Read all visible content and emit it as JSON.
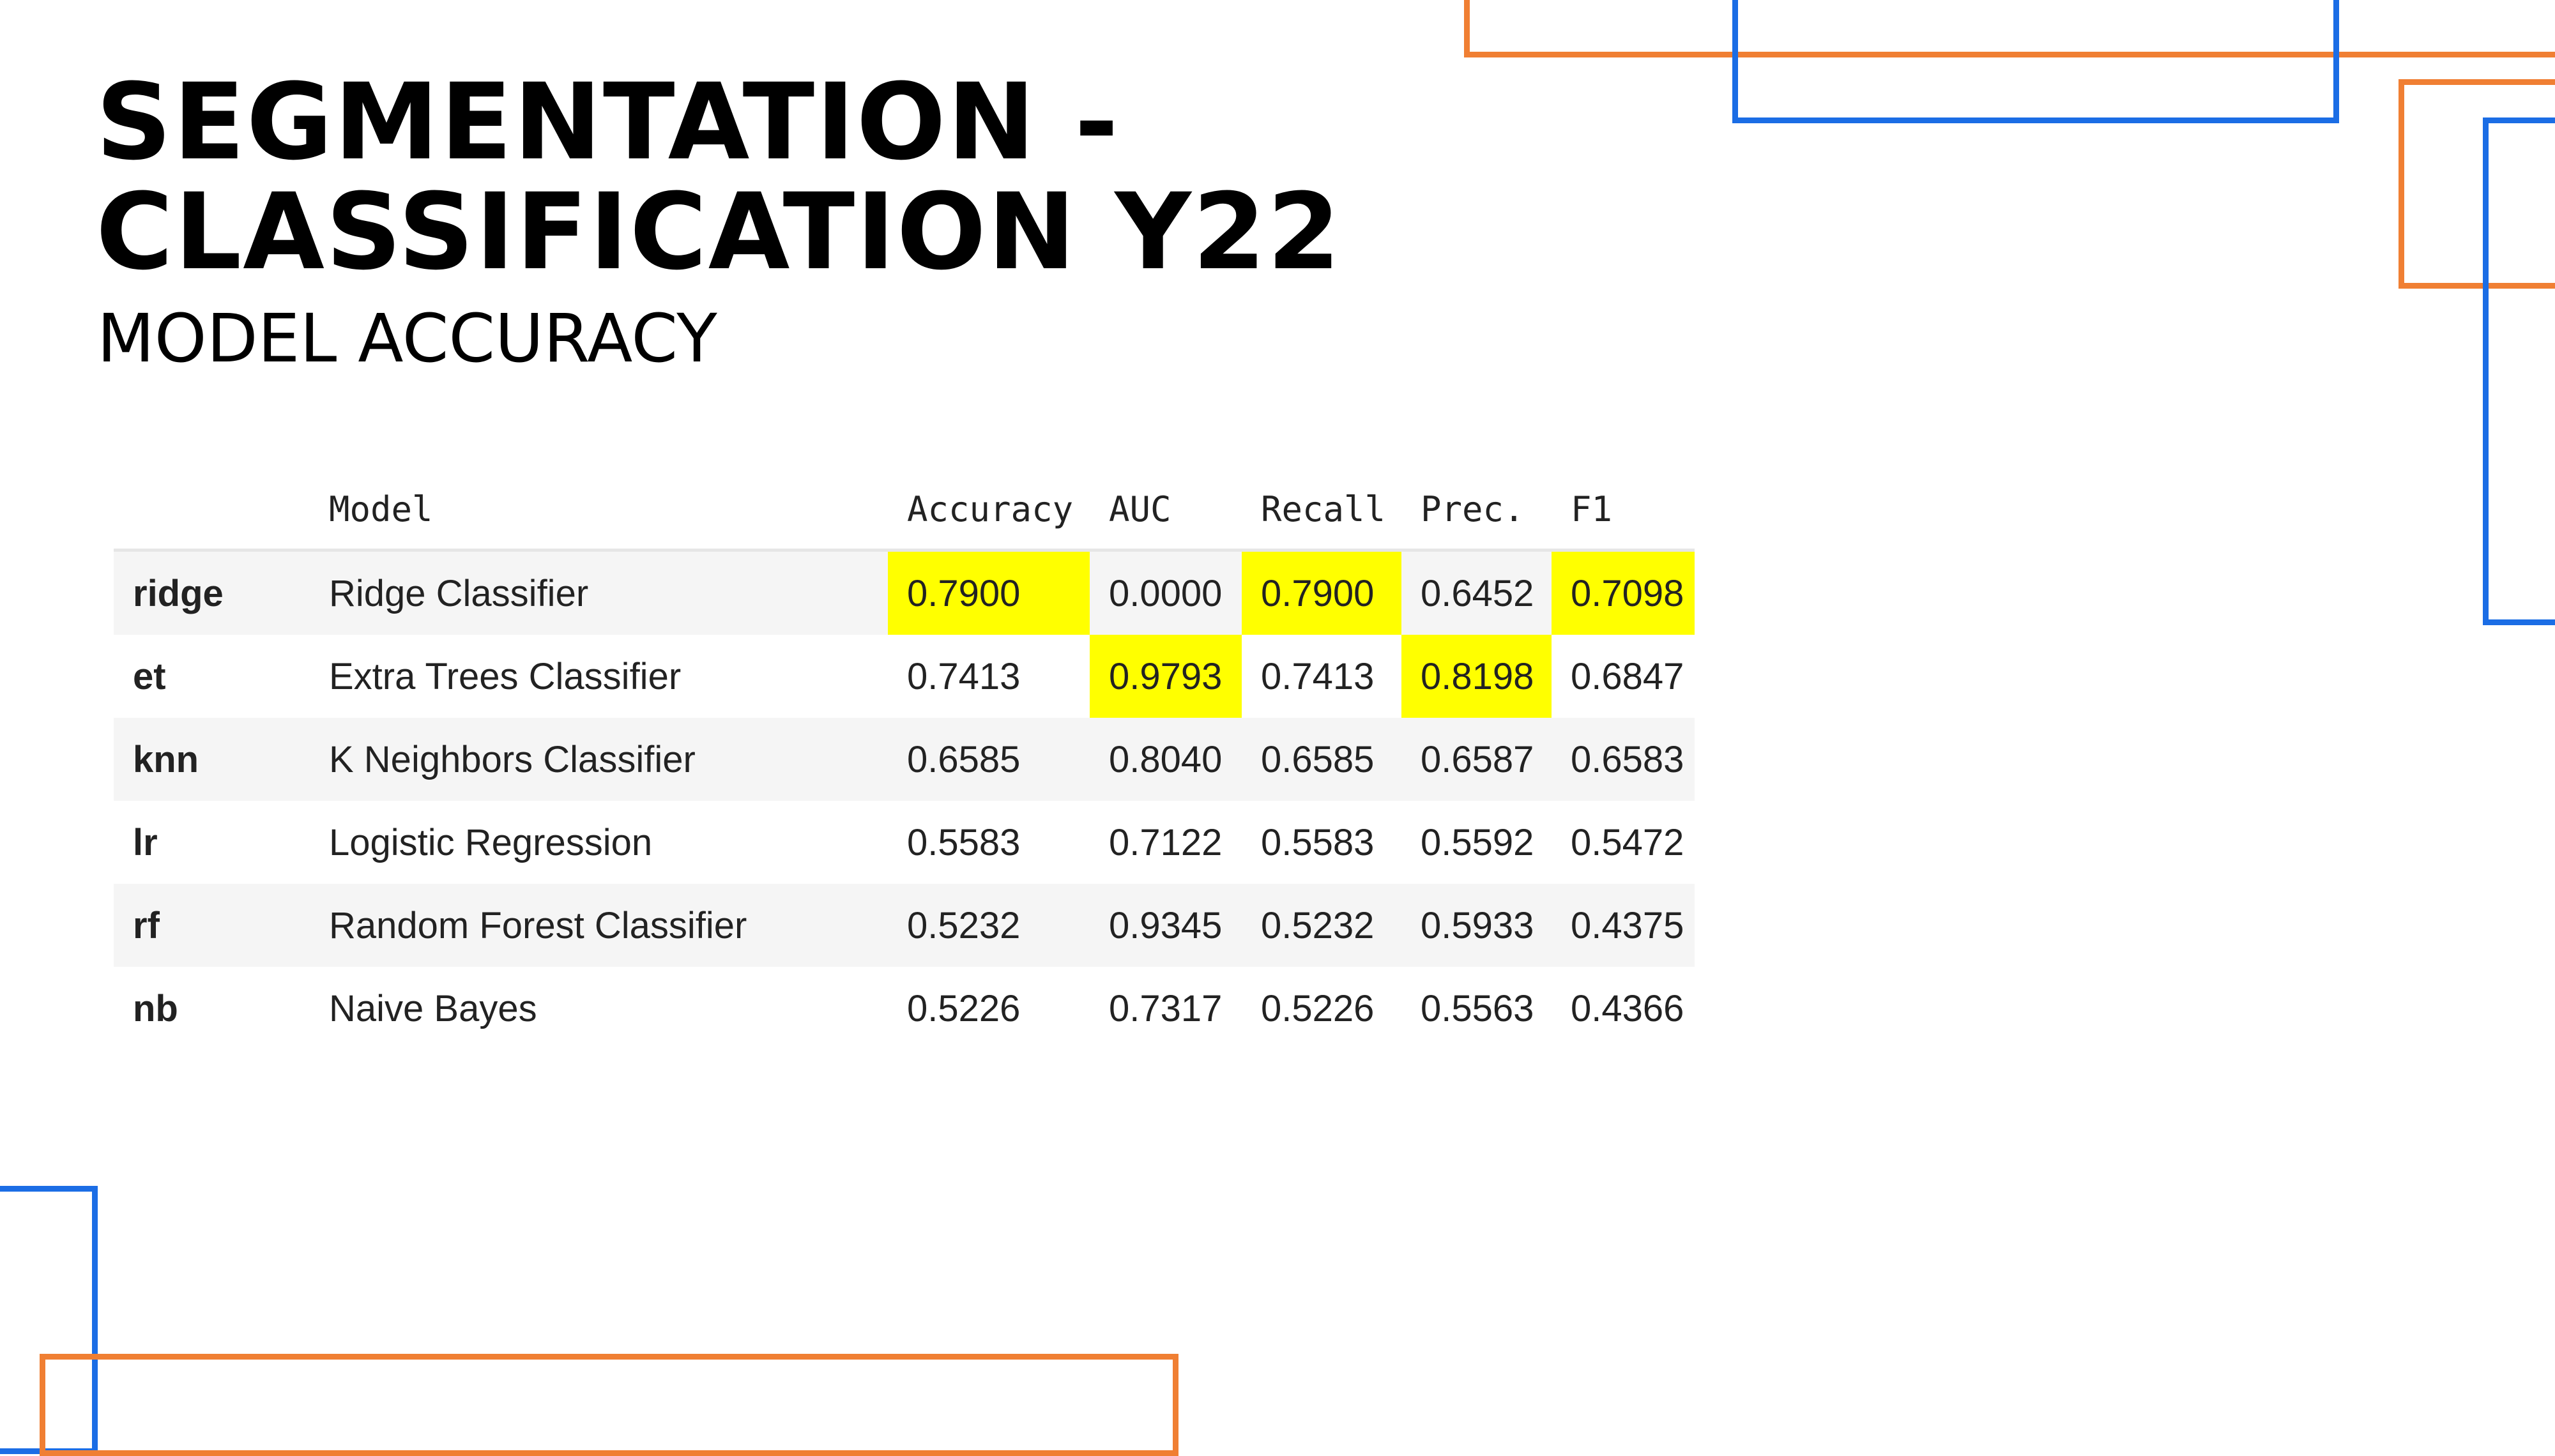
{
  "slide": {
    "title": "SEGMENTATION -\nCLASSIFICATION Y22",
    "subtitle": "MODEL ACCURACY"
  },
  "theme": {
    "accent_orange": "#f07f33",
    "accent_blue": "#1b6de5",
    "highlight": "#ffff00"
  },
  "table": {
    "headers": {
      "index": "",
      "model": "Model",
      "accuracy": "Accuracy",
      "auc": "AUC",
      "recall": "Recall",
      "prec": "Prec.",
      "f1": "F1"
    },
    "rows": [
      {
        "id": "ridge",
        "model": "Ridge Classifier",
        "accuracy": "0.7900",
        "auc": "0.0000",
        "recall": "0.7900",
        "prec": "0.6452",
        "f1": "0.7098",
        "highlighted": [
          "accuracy",
          "recall",
          "f1"
        ]
      },
      {
        "id": "et",
        "model": "Extra Trees Classifier",
        "accuracy": "0.7413",
        "auc": "0.9793",
        "recall": "0.7413",
        "prec": "0.8198",
        "f1": "0.6847",
        "highlighted": [
          "auc",
          "prec"
        ]
      },
      {
        "id": "knn",
        "model": "K Neighbors Classifier",
        "accuracy": "0.6585",
        "auc": "0.8040",
        "recall": "0.6585",
        "prec": "0.6587",
        "f1": "0.6583",
        "highlighted": []
      },
      {
        "id": "lr",
        "model": "Logistic Regression",
        "accuracy": "0.5583",
        "auc": "0.7122",
        "recall": "0.5583",
        "prec": "0.5592",
        "f1": "0.5472",
        "highlighted": []
      },
      {
        "id": "rf",
        "model": "Random Forest Classifier",
        "accuracy": "0.5232",
        "auc": "0.9345",
        "recall": "0.5232",
        "prec": "0.5933",
        "f1": "0.4375",
        "highlighted": []
      },
      {
        "id": "nb",
        "model": "Naive Bayes",
        "accuracy": "0.5226",
        "auc": "0.7317",
        "recall": "0.5226",
        "prec": "0.5563",
        "f1": "0.4366",
        "highlighted": []
      }
    ]
  }
}
